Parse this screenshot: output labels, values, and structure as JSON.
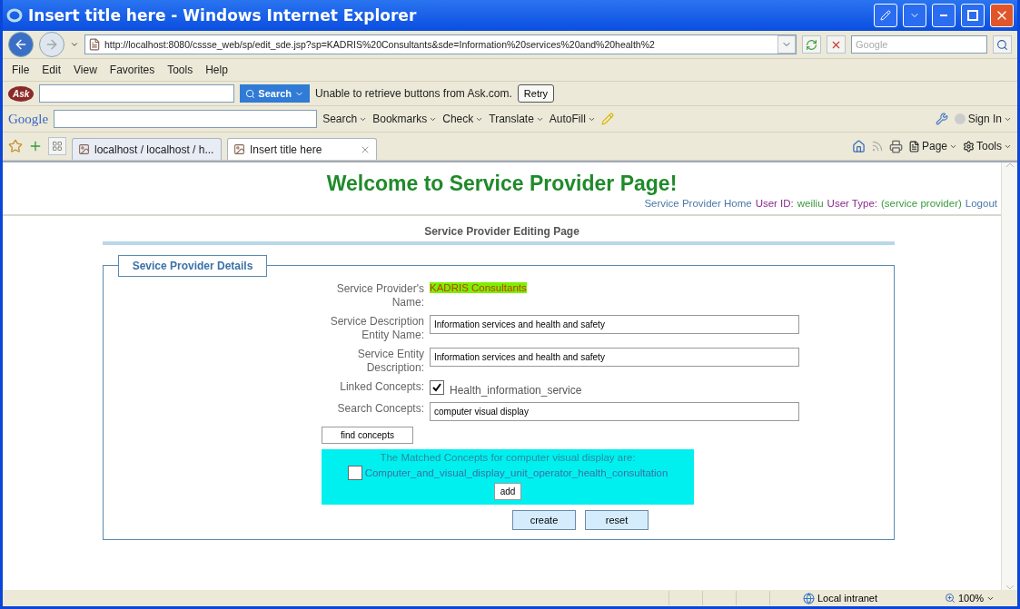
{
  "window": {
    "title": "Insert title here - Windows Internet Explorer"
  },
  "address_bar": {
    "url": "http://localhost:8080/cssse_web/sp/edit_sde.jsp?sp=KADRIS%20Consultants&sde=Information%20services%20and%20health%2",
    "search_placeholder": "Google"
  },
  "menu": [
    "File",
    "Edit",
    "View",
    "Favorites",
    "Tools",
    "Help"
  ],
  "ask_toolbar": {
    "logo": "Ask",
    "search_button": "Search",
    "message": "Unable to retrieve buttons from Ask.com.",
    "retry_button": "Retry"
  },
  "google_toolbar": {
    "logo": "Google",
    "items": [
      "Search",
      "Bookmarks",
      "Check",
      "Translate",
      "AutoFill"
    ],
    "sign_in": "Sign In"
  },
  "tabs": [
    {
      "label": "localhost / localhost / h...",
      "selected": false
    },
    {
      "label": "Insert title here",
      "selected": true
    }
  ],
  "command_bar": [
    "Page",
    "Tools"
  ],
  "page": {
    "heading": "Welcome to Service Provider Page!",
    "user_line": [
      {
        "text": "Service Provider Home",
        "kind": "link"
      },
      {
        "text": "User ID:",
        "kind": "label"
      },
      {
        "text": "weiliu",
        "kind": "value"
      },
      {
        "text": "User Type:",
        "kind": "label"
      },
      {
        "text": "(service provider)",
        "kind": "value"
      },
      {
        "text": "Logout",
        "kind": "link"
      }
    ],
    "subtitle": "Service Provider Editing Page",
    "legend": "Sevice Provider Details",
    "fields": [
      {
        "kind": "static",
        "label": "Service Provider's Name:",
        "value": "KADRIS Consultants"
      },
      {
        "kind": "input",
        "label": "Service Description Entity Name:",
        "value": "Information services and health and safety"
      },
      {
        "kind": "input",
        "label": "Service Entity Description:",
        "value": "Information services and health and safety"
      },
      {
        "kind": "checkbox",
        "label": "Linked Concepts:",
        "value": "Health_information_service",
        "checked": true
      },
      {
        "kind": "input",
        "label": "Search Concepts:",
        "value": "computer visual display"
      }
    ],
    "find_button": "find concepts",
    "matched": {
      "heading": "The Matched Concepts for computer visual display are:",
      "items": [
        {
          "label": "Computer_and_visual_display_unit_operator_health_consultation",
          "checked": false
        }
      ],
      "add_button": "add"
    },
    "buttons": [
      "create",
      "reset"
    ]
  },
  "status_bar": {
    "zone": "Local intranet",
    "zoom": "100%"
  }
}
